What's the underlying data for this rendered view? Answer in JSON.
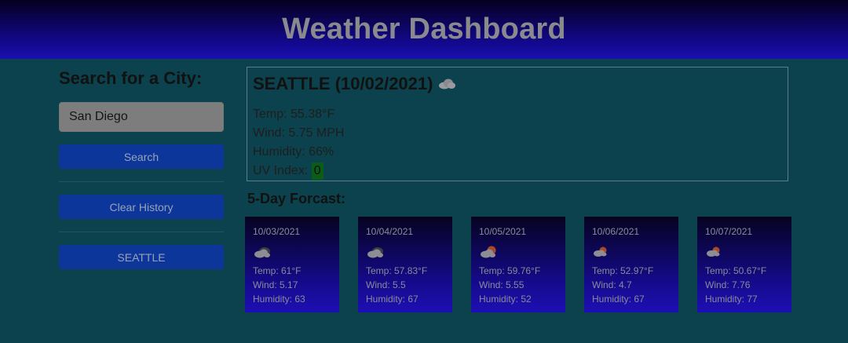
{
  "header": {
    "title": "Weather Dashboard"
  },
  "sidebar": {
    "heading": "Search for a City:",
    "input_value": "San Diego",
    "search_label": "Search",
    "clear_label": "Clear History",
    "history": [
      "SEATTLE"
    ]
  },
  "current": {
    "title": "SEATTLE (10/02/2021)",
    "icon": "cloud-icon",
    "temp": "Temp: 55.38°F",
    "wind": "Wind: 5.75 MPH",
    "humidity": "Humidity: 66%",
    "uv_label": "UV Index:",
    "uv_value": "0",
    "uv_color": "#0b5c16"
  },
  "forecast": {
    "title": "5-Day Forcast:",
    "days": [
      {
        "date": "10/03/2021",
        "icon": "broken-clouds-icon",
        "temp": "Temp: 61°F",
        "wind": "Wind: 5.17",
        "humidity": "Humidity: 63"
      },
      {
        "date": "10/04/2021",
        "icon": "broken-clouds-icon",
        "temp": "Temp: 57.83°F",
        "wind": "Wind: 5.5",
        "humidity": "Humidity: 67"
      },
      {
        "date": "10/05/2021",
        "icon": "sun-cloud-icon",
        "temp": "Temp: 59.76°F",
        "wind": "Wind: 5.55",
        "humidity": "Humidity: 52"
      },
      {
        "date": "10/06/2021",
        "icon": "sun-cloud-icon",
        "temp": "Temp: 52.97°F",
        "wind": "Wind: 4.7",
        "humidity": "Humidity: 67"
      },
      {
        "date": "10/07/2021",
        "icon": "sun-cloud-icon",
        "temp": "Temp: 50.67°F",
        "wind": "Wind: 7.76",
        "humidity": "Humidity: 77"
      }
    ]
  }
}
